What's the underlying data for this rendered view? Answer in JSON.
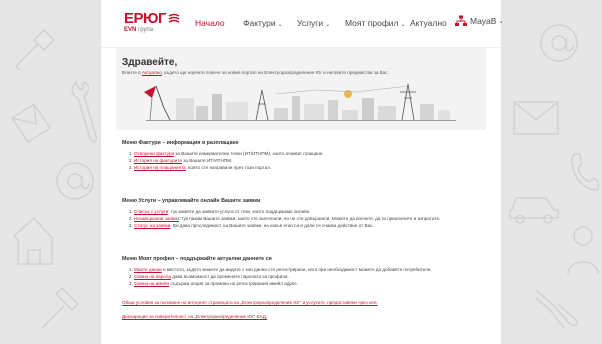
{
  "header": {
    "logo": {
      "main": "ЕРЮГ",
      "sub_brand": "EVN",
      "sub_text": "група"
    },
    "nav": [
      {
        "label": "Начало",
        "active": true,
        "dropdown": false
      },
      {
        "label": "Фактури",
        "active": false,
        "dropdown": true
      },
      {
        "label": "Услуги",
        "active": false,
        "dropdown": true
      },
      {
        "label": "Моят профил",
        "active": false,
        "dropdown": true
      },
      {
        "label": "Актуално",
        "active": false,
        "dropdown": false
      }
    ],
    "user": {
      "name": "MayaB",
      "icon": "sitemap-icon"
    }
  },
  "welcome": {
    "title": "Здравейте,",
    "text_before": "Влезте в ",
    "link": "Актуално",
    "text_after": ", където ще научите повече за новия портал на Електроразпределение Юг и неговите предимства за Вас."
  },
  "invoices": {
    "title": "Меню Фактури – информация и разплащане",
    "items": [
      {
        "link": "Отворени фактури",
        "text": " за Вашите измервателни точки (ИТ/ИТНПМ), които очакват плащане."
      },
      {
        "link": "История на фактурите",
        "text": " за Вашите ИТ/ИТНПМ."
      },
      {
        "link": "История на плащанията",
        "text": ", които сте направили през този портал."
      }
    ]
  },
  "services": {
    "title": "Меню Услуги – управлявайте онлайн Вашите заявки",
    "items": [
      {
        "link": "Списък с услуги",
        "text": ": тук можете да заявите услуга от тези, които поддържаме онлайн."
      },
      {
        "link": "Незавършени заявки",
        "text": ": тук пазим Вашите заявки, които сте започнали, но не сте довършили. Можете да влезете, да ги приключите и изпратите."
      },
      {
        "link": "Статус на заявки",
        "text": ": Ви дава проследимост на Вашите заявки, на какъв етап са и дали се очаква действие от Вас."
      }
    ]
  },
  "profile": {
    "title": "Меню Моят профил – поддържайте актуални данните си",
    "items": [
      {
        "link": "Моите данни",
        "text": " е мястото, където можете да видите с кои данни сте регистрирани, като при необходимост можете да добавяте потребители."
      },
      {
        "link": "Смяна на парола",
        "text": " дава възможност да промените паролата за профила."
      },
      {
        "link": "Смяна на имейл",
        "text": " съдържа опция за промяна на регистрирания имейл адрес."
      }
    ]
  },
  "footer_links": [
    "Общи условия за ползване на интернет страницата на „Електроразпределение Юг“ и услугите, предоставяни чрез нея.",
    "Декларация за поверителност на „Електроразпределение Юг“ ЕАД."
  ],
  "colors": {
    "brand": "#c8102e",
    "background": "#e6e6e6",
    "panel": "#f3f3f3"
  }
}
